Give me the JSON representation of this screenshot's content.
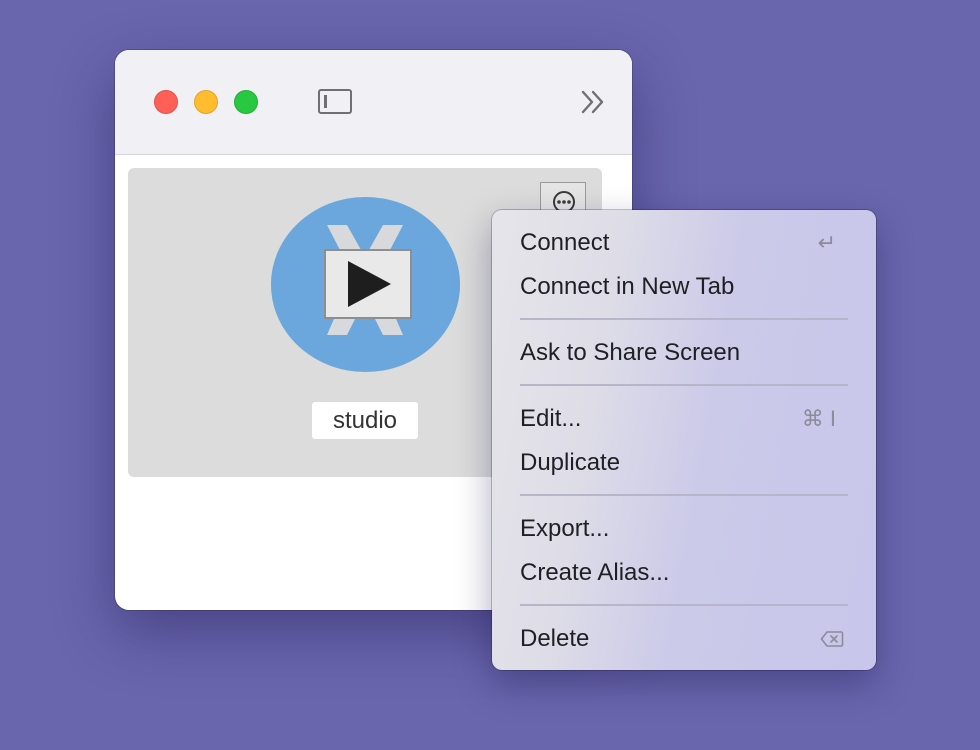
{
  "window": {
    "title_bar": {
      "buttons": [
        "close",
        "minimize",
        "maximize"
      ],
      "sidebar_toggle_icon": "sidebar-icon",
      "overflow_icon": "chevron-double-right-icon"
    },
    "tile": {
      "host_name": "studio",
      "logo_icon": "play-logo-icon",
      "more_icon": "ellipsis-circle-icon"
    }
  },
  "context_menu": {
    "connect": "Connect",
    "connect_shortcut": "↵",
    "connect_new_tab": "Connect in New Tab",
    "ask_share_screen": "Ask to Share Screen",
    "edit": "Edit...",
    "edit_shortcut": "⌘ I",
    "duplicate": "Duplicate",
    "export": "Export...",
    "create_alias": "Create Alias...",
    "delete": "Delete",
    "delete_shortcut_icon": "delete-key-icon"
  },
  "colors": {
    "background": "#6a66ae",
    "close": "#fe5f57",
    "minimize": "#febc2e",
    "maximize": "#28c840",
    "logo_circle": "#6ba6dd"
  }
}
